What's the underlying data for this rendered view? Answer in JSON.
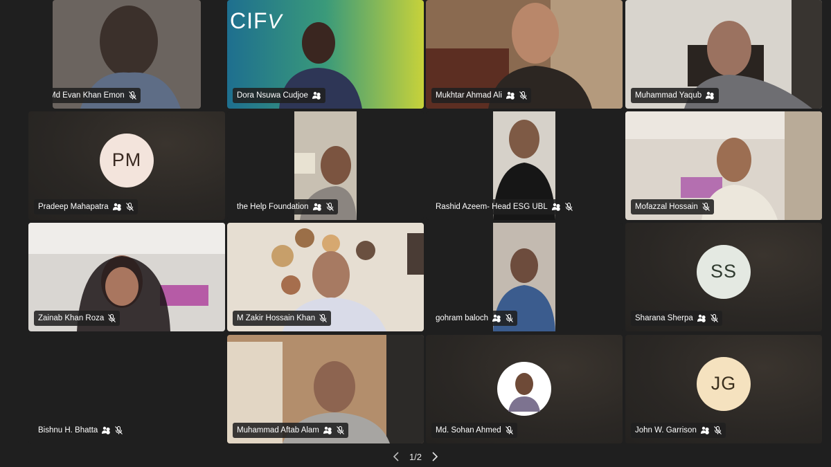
{
  "participants": [
    {
      "name": "Md Evan Khan Emon",
      "status_icon": "signal-icon"
    },
    {
      "name": "Dora Nsuwa Cudjoe",
      "status_icon": "hands-raised-icon"
    },
    {
      "name": "Mukhtar Ahmad Ali",
      "status_icon": "hands-raised-icon"
    },
    {
      "name": "Muhammad Yaqub",
      "status_icon": "hands-raised-icon"
    },
    {
      "name": "Pradeep Mahapatra",
      "initials": "PM",
      "status_icon": "hands-raised-icon"
    },
    {
      "name": "the Help Foundation",
      "status_icon": "hands-raised-icon"
    },
    {
      "name": "Rashid Azeem- Head ESG UBL",
      "status_icon": "hands-raised-icon"
    },
    {
      "name": "Mofazzal Hossain",
      "status_icon": "none"
    },
    {
      "name": "Zainab Khan Roza",
      "status_icon": "none"
    },
    {
      "name": "M Zakir Hossain Khan",
      "status_icon": "none"
    },
    {
      "name": "gohram baloch",
      "status_icon": "hands-raised-icon"
    },
    {
      "name": "Sharana Sherpa",
      "initials": "SS",
      "status_icon": "hands-raised-icon"
    },
    {
      "name": "Bishnu H. Bhatta",
      "status_icon": "hands-raised-icon"
    },
    {
      "name": "Muhammad Aftab Alam",
      "status_icon": "hands-raised-icon"
    },
    {
      "name": "Md. Sohan Ahmed",
      "status_icon": "none"
    },
    {
      "name": "John W. Garrison",
      "initials": "JG",
      "status_icon": "hands-raised-icon"
    }
  ],
  "logo": {
    "text": "CIF"
  },
  "pagination": {
    "label": "1/2"
  },
  "colors": {
    "background": "#1f1f1f",
    "tile": "#292929",
    "avatar_bg": "#f3e4dc",
    "avatar_jg": "#f5e2bf"
  }
}
